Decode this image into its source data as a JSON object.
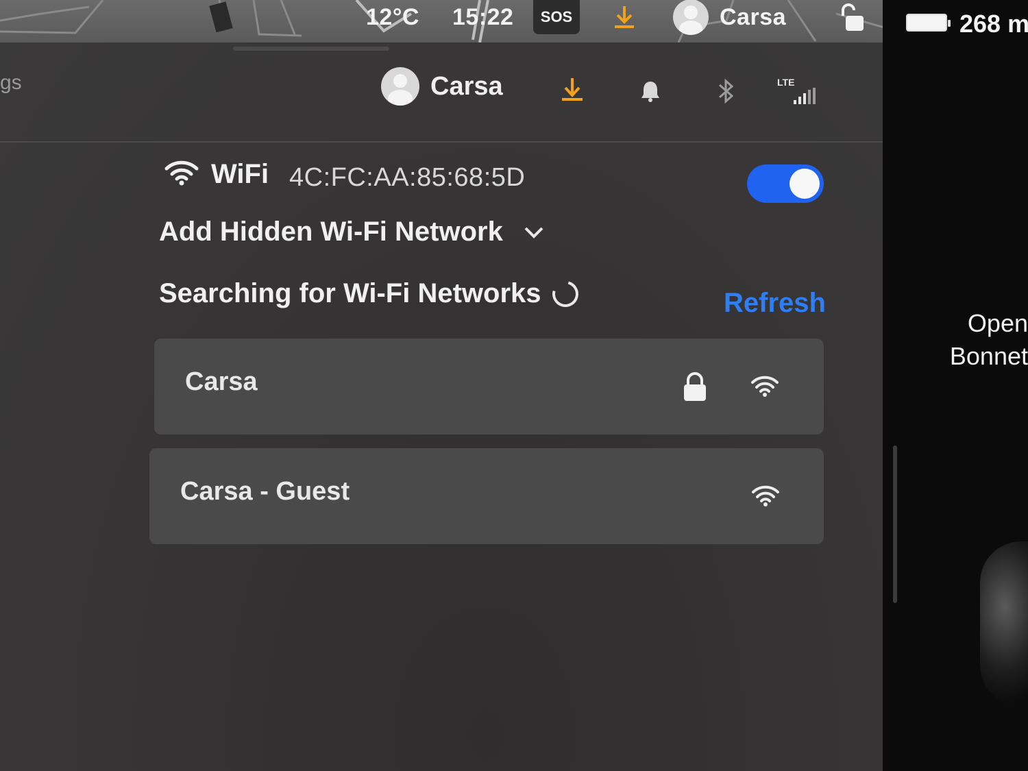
{
  "status_bar": {
    "temperature": "12°C",
    "time": "15:22",
    "sos_label": "SOS",
    "profile_name": "Carsa",
    "download_icon": "download-icon",
    "lock_icon": "padlock-open-icon"
  },
  "right_panel": {
    "range": "268 m",
    "bonnet_line1": "Open",
    "bonnet_line2": "Bonnet"
  },
  "settings_header": {
    "breadcrumb": "gs",
    "profile_name": "Carsa",
    "icons": [
      "download-icon",
      "bell-icon",
      "bluetooth-icon",
      "lte-signal-icon"
    ],
    "lte_label": "LTE"
  },
  "wifi": {
    "title": "WiFi",
    "mac_address": "4C:FC:AA:85:68:5D",
    "enabled": true,
    "add_hidden_label": "Add Hidden Wi-Fi Network",
    "searching_label": "Searching for Wi-Fi Networks",
    "refresh_label": "Refresh",
    "networks": [
      {
        "name": "Carsa",
        "secured": true,
        "icon": "wifi-signal-icon"
      },
      {
        "name": "Carsa - Guest",
        "secured": false,
        "icon": "wifi-signal-icon"
      }
    ]
  },
  "colors": {
    "accent_blue": "#2e7ff5",
    "toggle_on": "#1f63f0",
    "download_orange": "#f0a21a",
    "panel_bg": "#383636",
    "row_bg": "#4a4a4a"
  }
}
